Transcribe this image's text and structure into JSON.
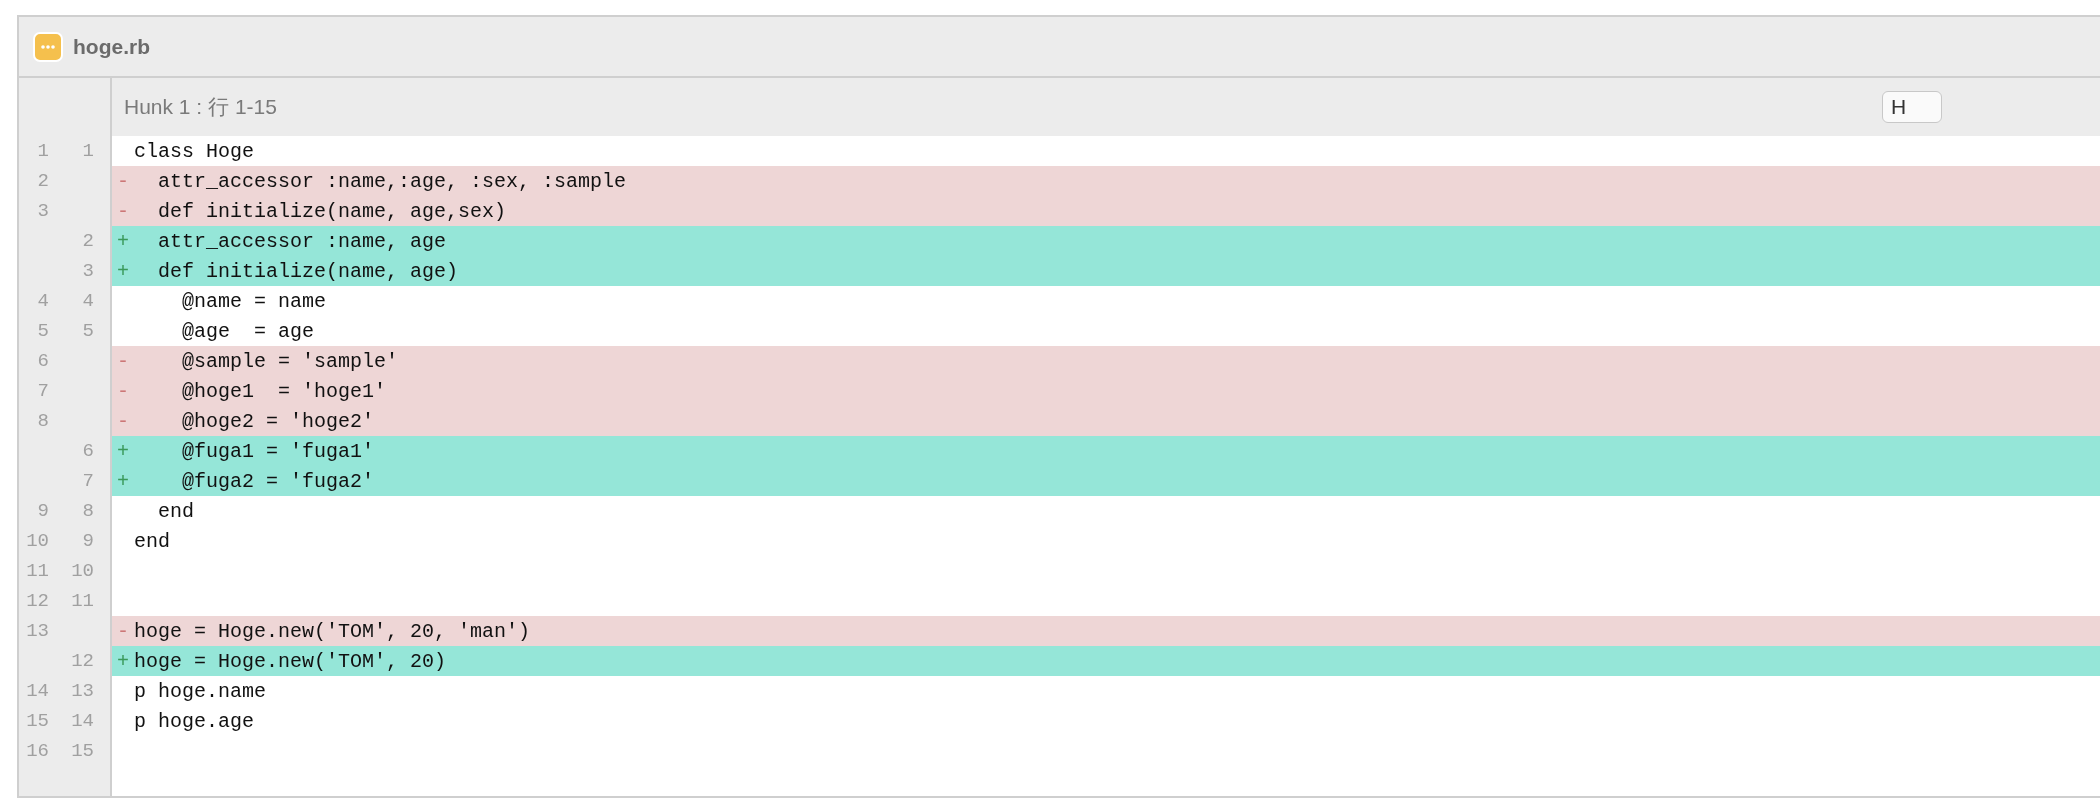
{
  "file": {
    "title": "hoge.rb"
  },
  "hunk": {
    "label": "Hunk 1 : 行 1-15",
    "button": "H"
  },
  "lines": [
    {
      "kind": "context",
      "old": "1",
      "new": "1",
      "text": "class Hoge"
    },
    {
      "kind": "removed",
      "old": "2",
      "marker": "-",
      "text": "  attr_accessor :name,:age, :sex, :sample"
    },
    {
      "kind": "removed",
      "old": "3",
      "marker": "-",
      "text": "  def initialize(name, age,sex)"
    },
    {
      "kind": "added",
      "new": "2",
      "marker": "+",
      "text": "  attr_accessor :name, age"
    },
    {
      "kind": "added",
      "new": "3",
      "marker": "+",
      "text": "  def initialize(name, age)"
    },
    {
      "kind": "context",
      "old": "4",
      "new": "4",
      "text": "    @name = name"
    },
    {
      "kind": "context",
      "old": "5",
      "new": "5",
      "text": "    @age  = age"
    },
    {
      "kind": "removed",
      "old": "6",
      "marker": "-",
      "text": "    @sample = 'sample'"
    },
    {
      "kind": "removed",
      "old": "7",
      "marker": "-",
      "text": "    @hoge1  = 'hoge1'"
    },
    {
      "kind": "removed",
      "old": "8",
      "marker": "-",
      "text": "    @hoge2 = 'hoge2'"
    },
    {
      "kind": "added",
      "new": "6",
      "marker": "+",
      "text": "    @fuga1 = 'fuga1'"
    },
    {
      "kind": "added",
      "new": "7",
      "marker": "+",
      "text": "    @fuga2 = 'fuga2'"
    },
    {
      "kind": "context",
      "old": "9",
      "new": "8",
      "text": "  end"
    },
    {
      "kind": "context",
      "old": "10",
      "new": "9",
      "text": "end"
    },
    {
      "kind": "context",
      "old": "11",
      "new": "10"
    },
    {
      "kind": "context",
      "old": "12",
      "new": "11"
    },
    {
      "kind": "removed",
      "old": "13",
      "marker": "-",
      "text": "hoge = Hoge.new('TOM', 20, 'man')"
    },
    {
      "kind": "added",
      "new": "12",
      "marker": "+",
      "text": "hoge = Hoge.new('TOM', 20)"
    },
    {
      "kind": "context",
      "old": "14",
      "new": "13",
      "text": "p hoge.name"
    },
    {
      "kind": "context",
      "old": "15",
      "new": "14",
      "text": "p hoge.age"
    },
    {
      "kind": "context",
      "old": "16",
      "new": "15"
    }
  ]
}
